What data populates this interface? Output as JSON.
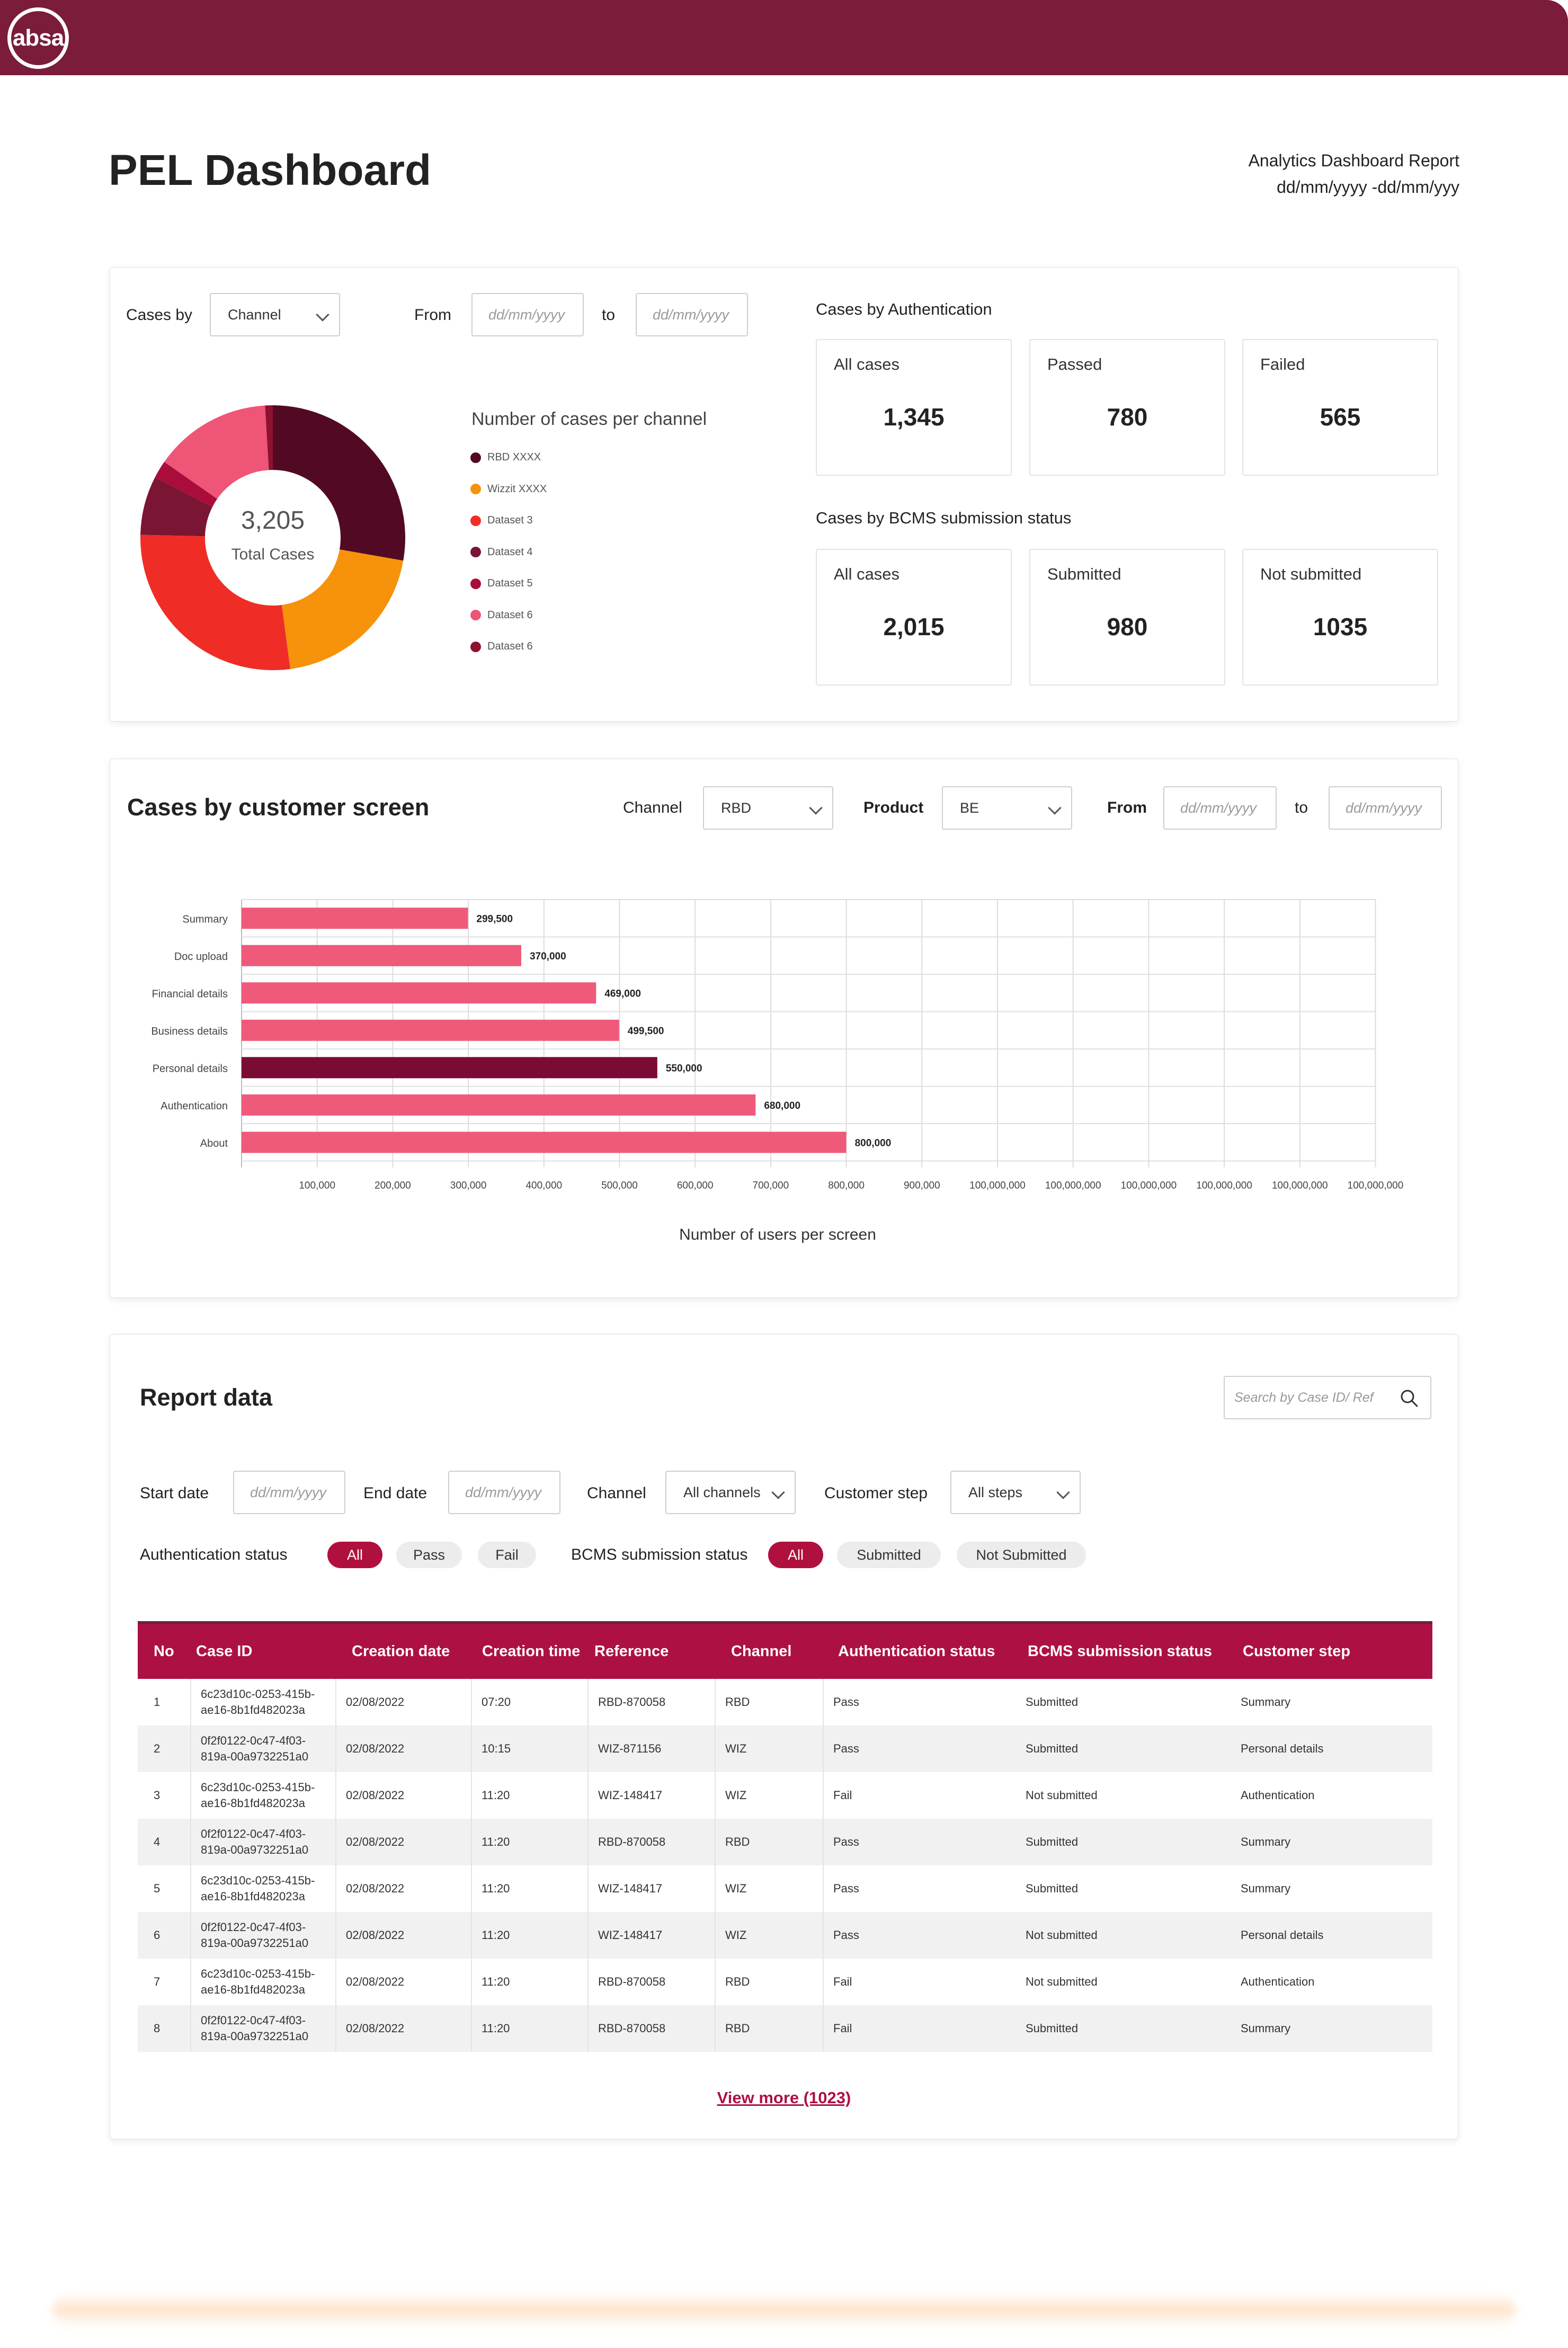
{
  "brand": {
    "logo_text": "absa",
    "primary": "#7a1c3a",
    "accent": "#ad1143"
  },
  "header": {
    "title": "PEL Dashboard",
    "report_title": "Analytics Dashboard Report",
    "report_range": "dd/mm/yyyy -dd/mm/yyy"
  },
  "channel_card": {
    "cases_by_label": "Cases by",
    "cases_by_value": "Channel",
    "from_label": "From",
    "to_label": "to",
    "date_placeholder": "dd/mm/yyyy",
    "chart_title": "Number of cases per channel",
    "total_value": "3,205",
    "total_label": "Total Cases"
  },
  "auth_section": {
    "title": "Cases by Authentication",
    "boxes": [
      {
        "label": "All cases",
        "value": "1,345"
      },
      {
        "label": "Passed",
        "value": "780"
      },
      {
        "label": "Failed",
        "value": "565"
      }
    ]
  },
  "bcms_section": {
    "title": "Cases by BCMS submission status",
    "boxes": [
      {
        "label": "All cases",
        "value": "2,015"
      },
      {
        "label": "Submitted",
        "value": "980"
      },
      {
        "label": "Not submitted",
        "value": "1035"
      }
    ]
  },
  "screen_card": {
    "title": "Cases by customer screen",
    "channel_label": "Channel",
    "channel_value": "RBD",
    "product_label": "Product",
    "product_value": "BE",
    "from_label": "From",
    "to_label": "to",
    "date_placeholder": "dd/mm/yyyy"
  },
  "chart_data": [
    {
      "type": "pie",
      "title": "Number of cases per channel",
      "center_value": "3,205",
      "center_label": "Total Cases",
      "categories": [
        "RBD XXXX",
        "Wizzit XXXX",
        "Dataset 3",
        "Dataset 4",
        "Dataset 5",
        "Dataset 6",
        "Dataset 6"
      ],
      "values": [
        890,
        645,
        880,
        230,
        70,
        460,
        30
      ],
      "colors": [
        "#520a24",
        "#f7920b",
        "#ef2d26",
        "#7a1533",
        "#aa0c3c",
        "#ee5577",
        "#8e1130"
      ],
      "legend": "right"
    },
    {
      "type": "bar",
      "orientation": "horizontal",
      "title": "",
      "xlabel": "Number of users per screen",
      "ylabel": "",
      "categories": [
        "Summary",
        "Doc upload",
        "Financial details",
        "Business details",
        "Personal details",
        "Authentication",
        "About"
      ],
      "values": [
        299500,
        370000,
        469000,
        499500,
        550000,
        680000,
        800000
      ],
      "value_labels": [
        "299,500",
        "370,000",
        "469,000",
        "499,500",
        "550,000",
        "680,000",
        "800,000"
      ],
      "highlight": "Personal details",
      "bar_color": "#ef5a7a",
      "highlight_color": "#7a0b35",
      "x_tick_labels": [
        "100,000",
        "200,000",
        "300,000",
        "400,000",
        "500,000",
        "600,000",
        "700,000",
        "800,000",
        "900,000",
        "100,000,000",
        "100,000,000",
        "100,000,000",
        "100,000,000",
        "100,000,000",
        "100,000,000"
      ],
      "grid": true
    }
  ],
  "report": {
    "title": "Report data",
    "search_placeholder": "Search by Case ID/ Ref",
    "start_date_label": "Start date",
    "end_date_label": "End date",
    "date_placeholder": "dd/mm/yyyy",
    "channel_label": "Channel",
    "channel_value": "All channels",
    "step_label": "Customer step",
    "step_value": "All steps",
    "auth_status_label": "Authentication status",
    "auth_pills": [
      "All",
      "Pass",
      "Fail"
    ],
    "bcms_status_label": "BCMS submission status",
    "bcms_pills": [
      "All",
      "Submitted",
      "Not Submitted"
    ],
    "columns": [
      "No",
      "Case ID",
      "Creation date",
      "Creation time",
      "Reference",
      "Channel",
      "Authentication status",
      "BCMS submission status",
      "Customer step"
    ],
    "rows": [
      [
        "1",
        "6c23d10c-0253-415b-ae16-8b1fd482023a",
        "02/08/2022",
        "07:20",
        "RBD-870058",
        "RBD",
        "Pass",
        "Submitted",
        "Summary"
      ],
      [
        "2",
        "0f2f0122-0c47-4f03-819a-00a9732251a0",
        "02/08/2022",
        "10:15",
        "WIZ-871156",
        "WIZ",
        "Pass",
        "Submitted",
        "Personal details"
      ],
      [
        "3",
        "6c23d10c-0253-415b-ae16-8b1fd482023a",
        "02/08/2022",
        "11:20",
        "WIZ-148417",
        "WIZ",
        "Fail",
        "Not submitted",
        "Authentication"
      ],
      [
        "4",
        "0f2f0122-0c47-4f03-819a-00a9732251a0",
        "02/08/2022",
        "11:20",
        "RBD-870058",
        "RBD",
        "Pass",
        "Submitted",
        "Summary"
      ],
      [
        "5",
        "6c23d10c-0253-415b-ae16-8b1fd482023a",
        "02/08/2022",
        "11:20",
        "WIZ-148417",
        "WIZ",
        "Pass",
        "Submitted",
        "Summary"
      ],
      [
        "6",
        "0f2f0122-0c47-4f03-819a-00a9732251a0",
        "02/08/2022",
        "11:20",
        "WIZ-148417",
        "WIZ",
        "Pass",
        "Not submitted",
        "Personal details"
      ],
      [
        "7",
        "6c23d10c-0253-415b-ae16-8b1fd482023a",
        "02/08/2022",
        "11:20",
        "RBD-870058",
        "RBD",
        "Fail",
        "Not submitted",
        "Authentication"
      ],
      [
        "8",
        "0f2f0122-0c47-4f03-819a-00a9732251a0",
        "02/08/2022",
        "11:20",
        "RBD-870058",
        "RBD",
        "Fail",
        "Submitted",
        "Summary"
      ]
    ],
    "view_more": "View more (1023)"
  }
}
